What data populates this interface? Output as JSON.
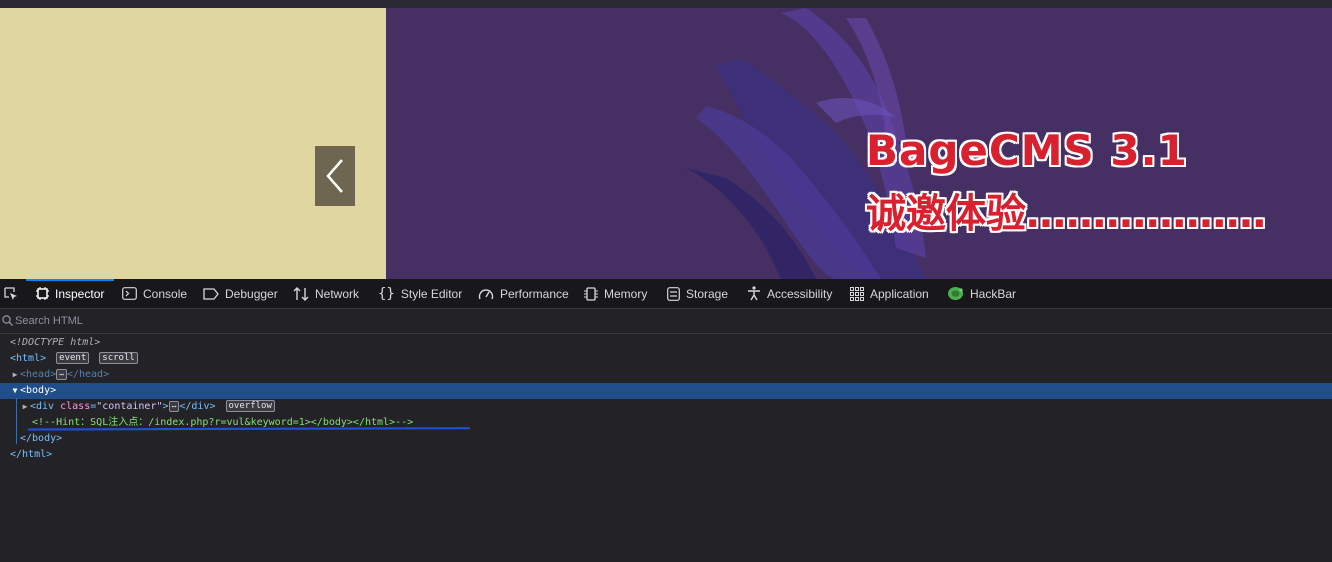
{
  "page": {
    "banner": {
      "title": "BageCMS 3.1",
      "subtitle": "诚邀体验………………"
    },
    "nav_arrow": "prev-arrow-icon"
  },
  "devtools": {
    "tabs": [
      {
        "label": "Inspector",
        "icon": "inspector-icon",
        "active": true
      },
      {
        "label": "Console",
        "icon": "console-icon"
      },
      {
        "label": "Debugger",
        "icon": "debugger-icon"
      },
      {
        "label": "Network",
        "icon": "network-icon"
      },
      {
        "label": "Style Editor",
        "icon": "style-editor-icon"
      },
      {
        "label": "Performance",
        "icon": "performance-icon"
      },
      {
        "label": "Memory",
        "icon": "memory-icon"
      },
      {
        "label": "Storage",
        "icon": "storage-icon"
      },
      {
        "label": "Accessibility",
        "icon": "accessibility-icon"
      },
      {
        "label": "Application",
        "icon": "application-icon"
      },
      {
        "label": "HackBar",
        "icon": "hackbar-icon"
      }
    ],
    "search_placeholder": "Search HTML",
    "tree": {
      "doctype": "<!DOCTYPE html>",
      "html_open": "<html",
      "html_open_end": ">",
      "event_badge": "event",
      "scroll_badge": "scroll",
      "head_open": "<head>",
      "head_close": "</head>",
      "body_open": "<body",
      "body_open_end": ">",
      "div_tag_open": "<div",
      "div_attr_name": "class",
      "div_attr_eq": "=",
      "div_attr_value": "\"container\"",
      "div_tag_end": ">",
      "div_close": "</div>",
      "overflow_badge": "overflow",
      "comment": "<!--Hint：SQL注入点：/index.php?r=vul&keyword=1></body></html>-->",
      "body_close": "</body>",
      "html_close": "</html>"
    }
  },
  "colors": {
    "left_pane": "#e0d7a0",
    "right_pane": "#452f63",
    "selection": "#204e8a",
    "annotation_underline": "#1f4fd6"
  }
}
